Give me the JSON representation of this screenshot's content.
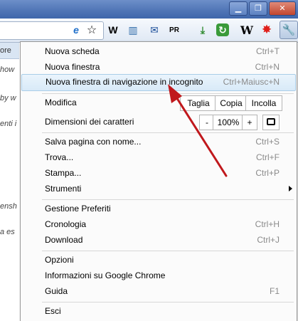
{
  "window": {
    "minimize": "▁",
    "maximize": "❐",
    "close": "✕"
  },
  "toolbar": {
    "extensions": [
      "e",
      "☆",
      "W",
      "▥",
      "✉",
      "PR",
      "⤓",
      "↻",
      "W",
      "✸"
    ],
    "extension_names": [
      "ie-tab-icon",
      "bookmark-star-icon",
      "web-developer-icon",
      "notes-icon",
      "gmail-icon",
      "pagerank-icon",
      "download-icon",
      "refresh-icon",
      "wikipedia-icon",
      "burst-icon"
    ],
    "wrench": "🔧"
  },
  "page": {
    "tab_label": "ore",
    "snippets": [
      "how",
      "by w",
      "enti i",
      "ensh",
      "a es"
    ]
  },
  "menu": {
    "new_tab": {
      "label": "Nuova scheda",
      "shortcut": "Ctrl+T"
    },
    "new_window": {
      "label": "Nuova finestra",
      "shortcut": "Ctrl+N"
    },
    "incognito": {
      "label": "Nuova finestra di navigazione in incognito",
      "shortcut": "Ctrl+Maiusc+N"
    },
    "edit": {
      "label": "Modifica",
      "cut": "Taglia",
      "copy": "Copia",
      "paste": "Incolla"
    },
    "zoom": {
      "label": "Dimensioni dei caratteri",
      "minus": "-",
      "value": "100%",
      "plus": "+"
    },
    "save_page": {
      "label": "Salva pagina con nome...",
      "shortcut": "Ctrl+S"
    },
    "find": {
      "label": "Trova...",
      "shortcut": "Ctrl+F"
    },
    "print": {
      "label": "Stampa...",
      "shortcut": "Ctrl+P"
    },
    "tools": {
      "label": "Strumenti"
    },
    "bookmarks_manager": {
      "label": "Gestione Preferiti"
    },
    "history": {
      "label": "Cronologia",
      "shortcut": "Ctrl+H"
    },
    "downloads": {
      "label": "Download",
      "shortcut": "Ctrl+J"
    },
    "options": {
      "label": "Opzioni"
    },
    "about": {
      "label": "Informazioni su Google Chrome"
    },
    "help": {
      "label": "Guida",
      "shortcut": "F1"
    },
    "exit": {
      "label": "Esci"
    }
  },
  "annotation": {
    "arrow_color": "#c0181c"
  }
}
